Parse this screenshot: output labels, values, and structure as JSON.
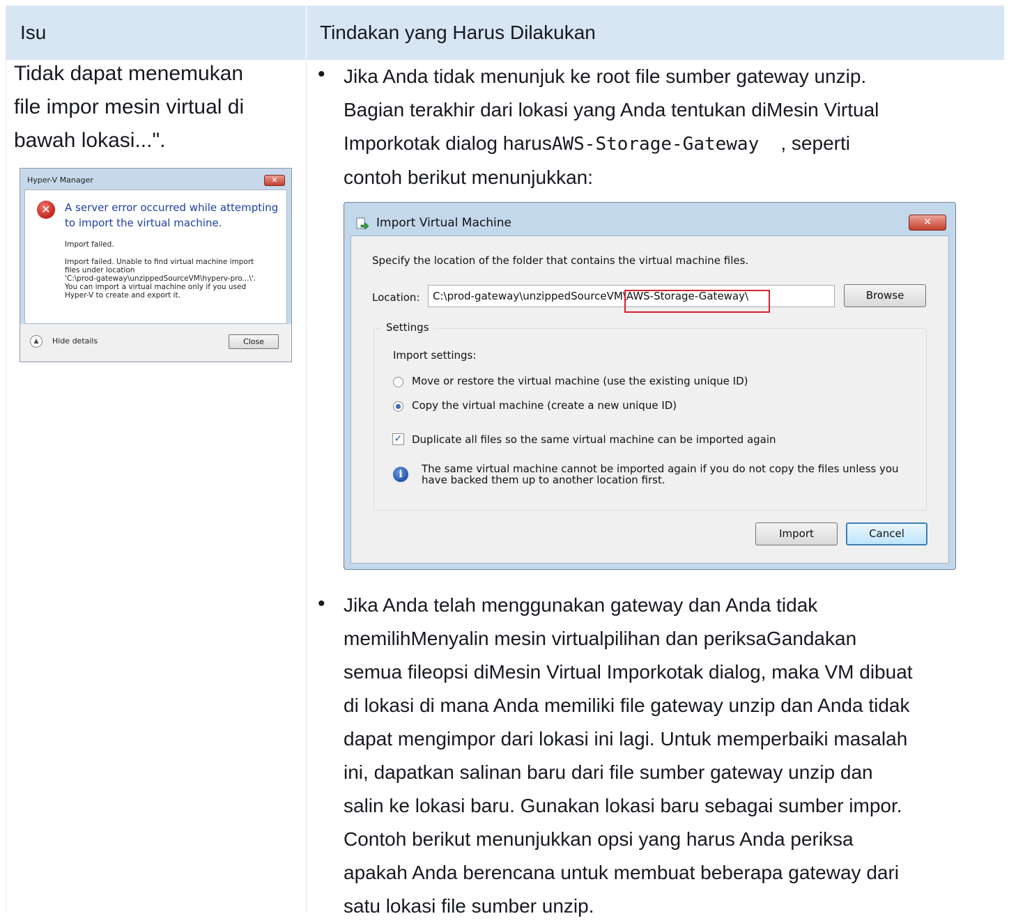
{
  "table": {
    "headers": [
      "Isu",
      "Tindakan yang Harus Dilakukan"
    ]
  },
  "issue": {
    "lines": [
      "Tidak dapat menemukan",
      "file impor mesin virtual di",
      "bawah lokasi...\"."
    ]
  },
  "hyperv_dialog": {
    "title": "Hyper-V Manager",
    "close_glyph": "✕",
    "main_message_lines": [
      "A server error occurred while attempting",
      "to import the virtual machine."
    ],
    "import_failed": "Import failed.",
    "details_lines": [
      "Import failed. Unable to find virtual machine import",
      "files under location",
      "'C:\\prod-gateway\\unzippedSourceVM\\hyperv-pro...\\'.",
      "You can import a virtual machine only if you used",
      "Hyper-V to create and export it."
    ],
    "hide_details": "Hide details",
    "close_button": "Close"
  },
  "bullet1": {
    "bullet_glyph": "•",
    "line1": "Jika Anda tidak menunjuk ke root file sumber gateway unzip.",
    "line2": "Bagian terakhir dari lokasi yang Anda tentukan diMesin Virtual",
    "line3_before": "Imporkotak dialog harus",
    "line3_code": "AWS-Storage-Gateway",
    "line3_after": ", seperti",
    "line4": "contoh berikut menunjukkan:"
  },
  "import_dialog": {
    "title": "Import Virtual Machine",
    "close_glyph": "✕",
    "spec_text": "Specify the location of the folder that contains the virtual machine files.",
    "location_label": "Location:",
    "location_value": "C:\\prod-gateway\\unzippedSourceVM\\AWS-Storage-Gateway\\",
    "browse": "Browse",
    "settings_label": "Settings",
    "import_settings": "Import settings:",
    "option_move": "Move or restore the virtual machine (use the existing unique ID)",
    "option_copy": "Copy the virtual machine (create a new unique ID)",
    "selected_option": "copy",
    "duplicate_label": "Duplicate all files so the same virtual machine can be imported again",
    "duplicate_checked": true,
    "check_glyph": "✓",
    "info_glyph": "i",
    "info_lines": [
      "The same virtual machine cannot be imported again if you do not copy the files unless you",
      "have backed them up to another location first."
    ],
    "import_button": "Import",
    "cancel_button": "Cancel"
  },
  "bullet2": {
    "bullet_glyph": "•",
    "lines": [
      "Jika Anda telah menggunakan gateway dan Anda tidak",
      "memilihMenyalin mesin virtualpilihan dan periksaGandakan",
      "semua fileopsi diMesin Virtual Imporkotak dialog, maka VM dibuat",
      "di lokasi di mana Anda memiliki file gateway unzip dan Anda tidak",
      "dapat mengimpor dari lokasi ini lagi. Untuk memperbaiki masalah",
      "ini, dapatkan salinan baru dari file sumber gateway unzip dan",
      "salin ke lokasi baru. Gunakan lokasi baru sebagai sumber impor.",
      "Contoh berikut menunjukkan opsi yang harus Anda periksa",
      "apakah Anda berencana untuk membuat beberapa gateway dari",
      "satu lokasi file sumber unzip."
    ]
  }
}
